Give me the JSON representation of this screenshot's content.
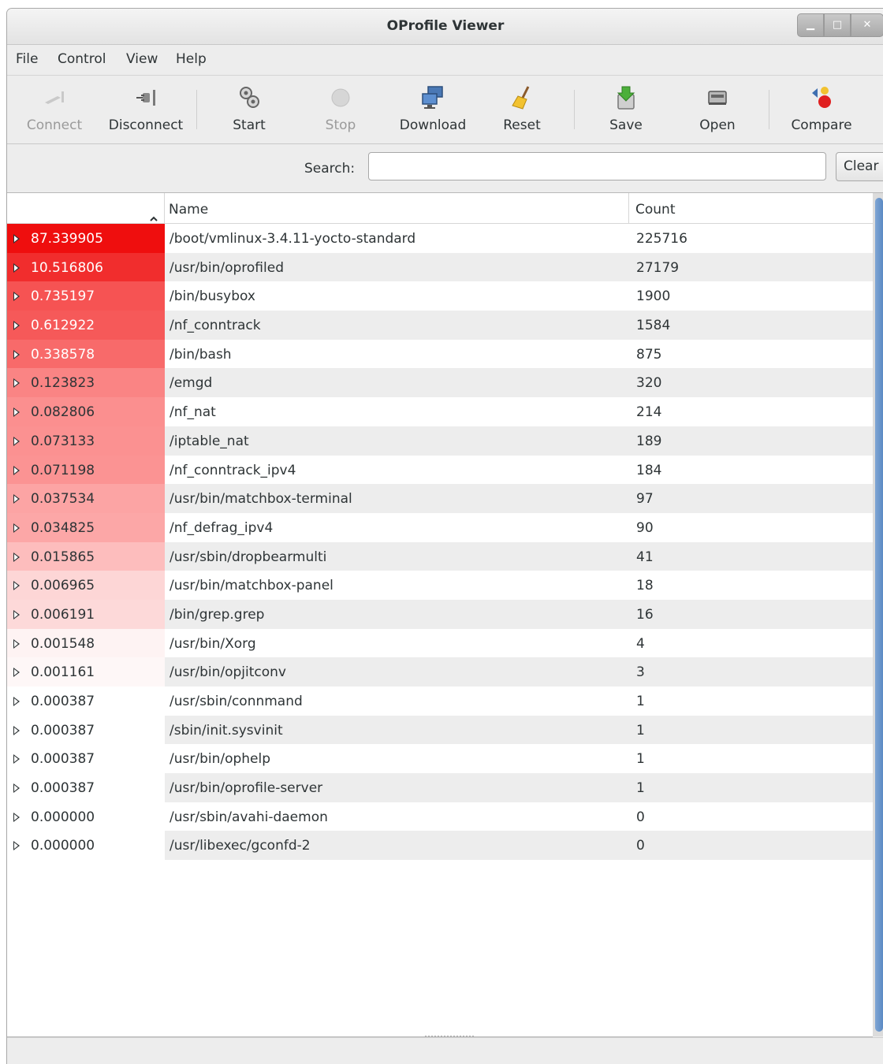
{
  "window": {
    "title": "OProfile Viewer"
  },
  "menu": [
    "File",
    "Control",
    "View",
    "Help"
  ],
  "toolbar": {
    "connect": "Connect",
    "disconnect": "Disconnect",
    "start": "Start",
    "stop": "Stop",
    "download": "Download",
    "reset": "Reset",
    "save": "Save",
    "open": "Open",
    "compare": "Compare"
  },
  "search": {
    "label": "Search:",
    "value": "",
    "clear": "Clear"
  },
  "table": {
    "headers": {
      "percent": "",
      "name": "Name",
      "count": "Count"
    },
    "sort_indicator": "^",
    "rows": [
      {
        "pct": "87.339905",
        "name": "/boot/vmlinux-3.4.11-yocto-standard",
        "count": "225716",
        "color": "#ef0e0e",
        "text": "#ffffff"
      },
      {
        "pct": "10.516806",
        "name": "/usr/bin/oprofiled",
        "count": "27179",
        "color": "#f12d2d",
        "text": "#ffffff"
      },
      {
        "pct": "0.735197",
        "name": "/bin/busybox",
        "count": "1900",
        "color": "#f65353",
        "text": "#ffffff"
      },
      {
        "pct": "0.612922",
        "name": "/nf_conntrack",
        "count": "1584",
        "color": "#f65959",
        "text": "#ffffff"
      },
      {
        "pct": "0.338578",
        "name": "/bin/bash",
        "count": "875",
        "color": "#f86a6a",
        "text": "#ffffff"
      },
      {
        "pct": "0.123823",
        "name": "/emgd",
        "count": "320",
        "color": "#fa8484",
        "text": "#2e3436"
      },
      {
        "pct": "0.082806",
        "name": "/nf_nat",
        "count": "214",
        "color": "#fb8f8f",
        "text": "#2e3436"
      },
      {
        "pct": "0.073133",
        "name": "/iptable_nat",
        "count": "189",
        "color": "#fb9191",
        "text": "#2e3436"
      },
      {
        "pct": "0.071198",
        "name": "/nf_conntrack_ipv4",
        "count": "184",
        "color": "#fb9393",
        "text": "#2e3436"
      },
      {
        "pct": "0.037534",
        "name": "/usr/bin/matchbox-terminal",
        "count": "97",
        "color": "#fca4a4",
        "text": "#2e3436"
      },
      {
        "pct": "0.034825",
        "name": "/nf_defrag_ipv4",
        "count": "90",
        "color": "#fca7a7",
        "text": "#2e3436"
      },
      {
        "pct": "0.015865",
        "name": "/usr/sbin/dropbearmulti",
        "count": "41",
        "color": "#fdbdbd",
        "text": "#2e3436"
      },
      {
        "pct": "0.006965",
        "name": "/usr/bin/matchbox-panel",
        "count": "18",
        "color": "#fdd6d6",
        "text": "#2e3436"
      },
      {
        "pct": "0.006191",
        "name": "/bin/grep.grep",
        "count": "16",
        "color": "#fdd9d9",
        "text": "#2e3436"
      },
      {
        "pct": "0.001548",
        "name": "/usr/bin/Xorg",
        "count": "4",
        "color": "#fef3f3",
        "text": "#2e3436"
      },
      {
        "pct": "0.001161",
        "name": "/usr/bin/opjitconv",
        "count": "3",
        "color": "#fef7f7",
        "text": "#2e3436"
      },
      {
        "pct": "0.000387",
        "name": "/usr/sbin/connmand",
        "count": "1",
        "color": "#ffffff",
        "text": "#2e3436"
      },
      {
        "pct": "0.000387",
        "name": "/sbin/init.sysvinit",
        "count": "1",
        "color": "#ffffff",
        "text": "#2e3436"
      },
      {
        "pct": "0.000387",
        "name": "/usr/bin/ophelp",
        "count": "1",
        "color": "#ffffff",
        "text": "#2e3436"
      },
      {
        "pct": "0.000387",
        "name": "/usr/bin/oprofile-server",
        "count": "1",
        "color": "#ffffff",
        "text": "#2e3436"
      },
      {
        "pct": "0.000000",
        "name": "/usr/sbin/avahi-daemon",
        "count": "0",
        "color": "#ffffff",
        "text": "#2e3436"
      },
      {
        "pct": "0.000000",
        "name": "/usr/libexec/gconfd-2",
        "count": "0",
        "color": "#ffffff",
        "text": "#2e3436"
      }
    ]
  }
}
